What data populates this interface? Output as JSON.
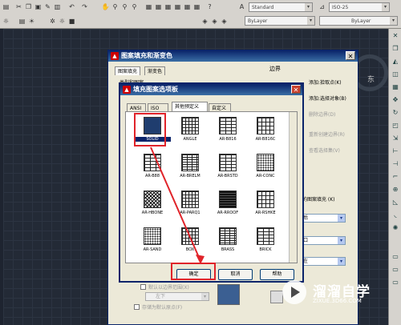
{
  "toolbar": {
    "text_style": "Standard",
    "dim_style": "ISO-25",
    "layer_color": "ByLayer",
    "linetype": "ByLayer"
  },
  "drawing": {
    "compass_label": "东"
  },
  "hatch_dialog": {
    "title": "图案填充和渐变色",
    "tab_hatch": "图案填充",
    "tab_gradient": "渐变色",
    "type_label": "类型和图案",
    "boundary_title": "边界",
    "add_pick_points": "添加:拾取点(K)",
    "add_select_objects": "添加:选择对象(B)",
    "remove_boundaries": "删除边界(D)",
    "recreate_boundary": "重新创建边界(R)",
    "view_selections": "查看选择集(V)",
    "inherit_label": "的图案填充 (K)",
    "select_1": "后",
    "options_label": "口",
    "draw_order": "在",
    "use_current_origin": "默认以边界范围(X)",
    "bottom_left": "左下",
    "store_origin": "存储为默认原点(F)",
    "color_swatch": "#1f3d6e"
  },
  "palette_dialog": {
    "title": "填充图案选项板",
    "tabs": [
      "ANSI",
      "ISO",
      "其他预定义",
      "自定义"
    ],
    "active_tab": "其他预定义",
    "patterns": [
      {
        "name": "SOLID",
        "pattern": "solid"
      },
      {
        "name": "ANGLE",
        "pattern": "grid"
      },
      {
        "name": "AR-B816",
        "pattern": "brick"
      },
      {
        "name": "AR-B816C",
        "pattern": "brick2"
      },
      {
        "name": "AR-B88",
        "pattern": "brick"
      },
      {
        "name": "AR-BRELM",
        "pattern": "stone"
      },
      {
        "name": "AR-BRSTD",
        "pattern": "brick"
      },
      {
        "name": "AR-CONC",
        "pattern": "dots"
      },
      {
        "name": "AR-HBONE",
        "pattern": "diag"
      },
      {
        "name": "AR-PARQ1",
        "pattern": "grid"
      },
      {
        "name": "AR-RROOF",
        "pattern": "roof"
      },
      {
        "name": "AR-RSHKE",
        "pattern": "brick2"
      },
      {
        "name": "AR-SAND",
        "pattern": "dots"
      },
      {
        "name": "BOX",
        "pattern": "grid"
      },
      {
        "name": "BRASS",
        "pattern": "stone"
      },
      {
        "name": "BRICK",
        "pattern": "brick"
      }
    ],
    "selected_pattern": "SOLID",
    "ok": "确定",
    "cancel": "取消",
    "help": "帮助"
  },
  "watermark": {
    "name_cn": "溜溜自学",
    "url": "ZIXUE.3D66.COM"
  }
}
